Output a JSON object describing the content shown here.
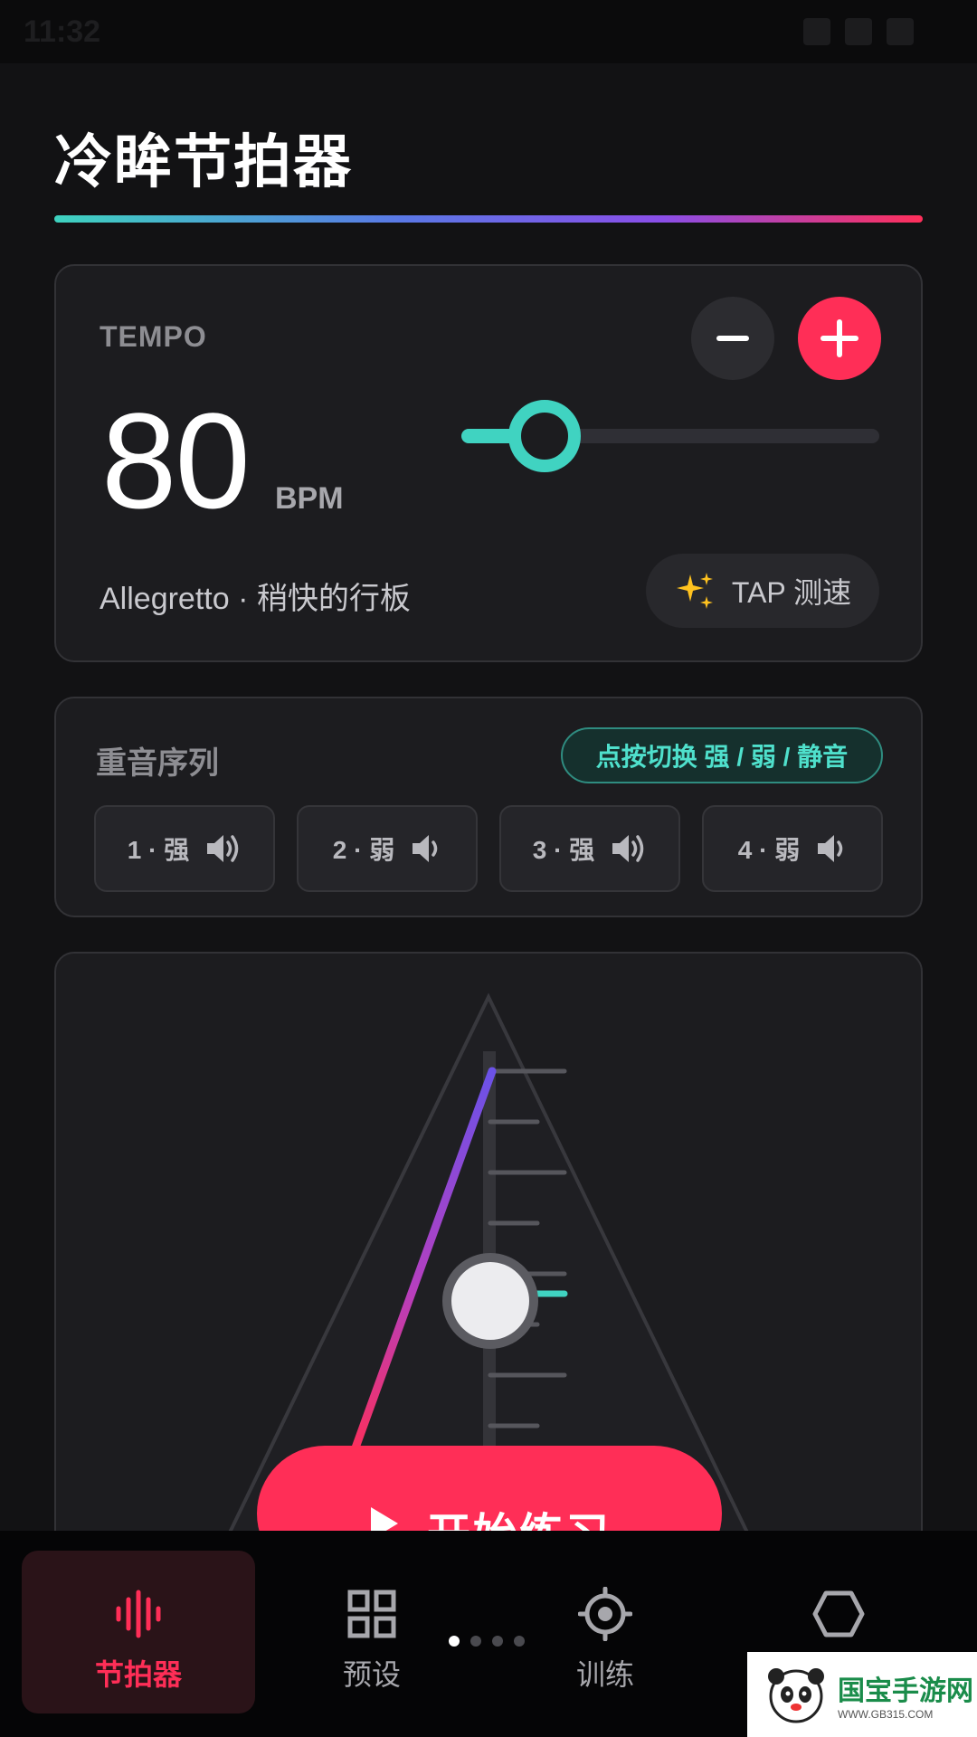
{
  "status_bar": {
    "time": "11:32"
  },
  "header": {
    "title": "冷眸节拍器"
  },
  "tempo": {
    "label": "TEMPO",
    "bpm": "80",
    "unit": "BPM",
    "slider_fraction": 0.2,
    "tempo_name": "Allegretto · 稍快的行板",
    "tap_label": "TAP 测速"
  },
  "accent": {
    "title": "重音序列",
    "hint": "点按切换 强 / 弱 / 静音",
    "beats": [
      {
        "label": "1 · 强"
      },
      {
        "label": "2 · 弱"
      },
      {
        "label": "3 · 强"
      },
      {
        "label": "4 · 弱"
      }
    ]
  },
  "start_button": {
    "label": "开始练习"
  },
  "nav": {
    "items": [
      {
        "label": "节拍器"
      },
      {
        "label": "预设"
      },
      {
        "label": "训练"
      }
    ]
  },
  "watermark": {
    "title": "国宝手游网",
    "url": "WWW.GB315.COM"
  },
  "colors": {
    "accent": "#ff2e57",
    "teal": "#40d3c1",
    "background": "#121214",
    "card": "#1c1c1f"
  }
}
